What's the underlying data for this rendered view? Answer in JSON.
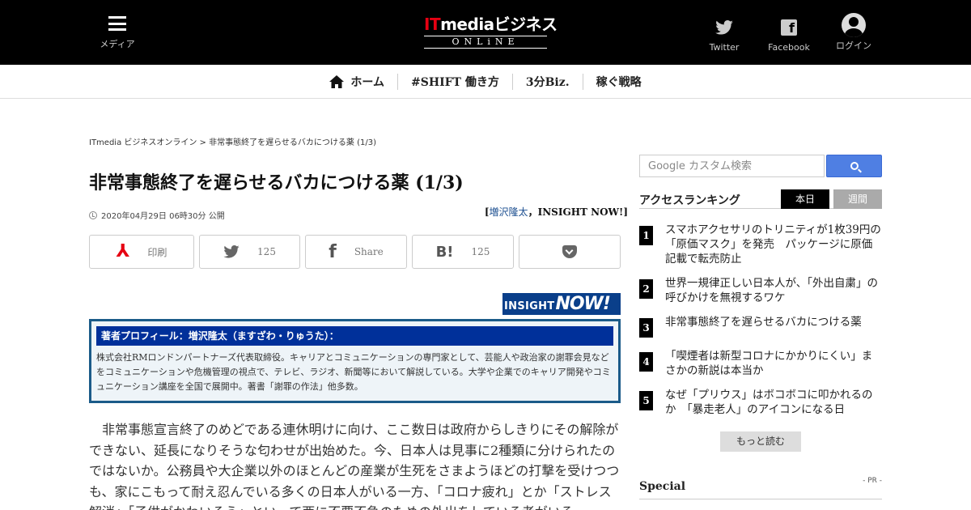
{
  "header": {
    "menu_label": "メディア",
    "logo_it": "IT",
    "logo_main": "mediaビジネス",
    "logo_sub": "ONLiNE",
    "twitter_label": "Twitter",
    "facebook_label": "Facebook",
    "login_label": "ログイン",
    "facebook_glyph": "f"
  },
  "nav": {
    "items": [
      {
        "label": "ホーム"
      },
      {
        "label": "#SHIFT 働き方"
      },
      {
        "label": "3分Biz."
      },
      {
        "label": "稼ぐ戦略"
      }
    ]
  },
  "article": {
    "breadcrumb": "ITmedia ビジネスオンライン > 非常事態終了を遅らせるバカにつける薬 (1/3)",
    "title": "非常事態終了を遅らせるバカにつける薬 (1/3)",
    "date": "2020年04月29日 06時30分 公開",
    "author_open": "[",
    "author_name": "増沢隆太",
    "author_sep": "，",
    "author_org": "INSIGHT NOW!",
    "author_close": "]",
    "share": {
      "print_label": "印刷",
      "twitter_count": "125",
      "facebook_label": "Share",
      "hatena_count": "125",
      "pdf_glyph": "⅄",
      "facebook_glyph": "f",
      "hatena_glyph": "B!"
    },
    "badge_a": "INSIGHT",
    "badge_b": "NOW!",
    "profile_head": "著者プロフィール：増沢隆太（ますざわ・りゅうた）：",
    "profile_body": "株式会社RMロンドンパートナーズ代表取締役。キャリアとコミュニケーションの専門家として、芸能人や政治家の謝罪会見などをコミュニケーションや危機管理の視点で、テレビ、ラジオ、新聞等において解説している。大学や企業でのキャリア開発やコミュニケーション講座を全国で展開中。著書「謝罪の作法」他多数。",
    "body": "非常事態宣言終了のめどである連休明けに向け、ここ数日は政府からしきりにその解除ができない、延長になりそうな匂わせが出始めた。今、日本人は見事に2種類に分けられたのではないか。公務員や大企業以外のほとんどの産業が生死をさまようほどの打撃を受けつつも、家にこもって耐え忍んでいる多くの日本人がいる一方、「コロナ疲れ」とか「ストレス解消」「子供がかわいそう」といって西に不要不急のための外出をしている者がいる。"
  },
  "sidebar": {
    "search_placeholder": "Google カスタム検索",
    "ranking_title": "アクセスランキング",
    "tab_today": "本日",
    "tab_week": "週間",
    "ranking": [
      {
        "num": "1",
        "text": "スマホアクセサリのトリニティが1枚39円の「原価マスク」を発売　パッケージに原価記載で転売防止"
      },
      {
        "num": "2",
        "text": "世界一規律正しい日本人が、「外出自粛」の呼びかけを無視するワケ"
      },
      {
        "num": "3",
        "text": "非常事態終了を遅らせるバカにつける薬"
      },
      {
        "num": "4",
        "text": "「喫煙者は新型コロナにかかりにくい」まさかの新説は本当か"
      },
      {
        "num": "5",
        "text": "なぜ「プリウス」はボコボコに叩かれるのか　「暴走老人」のアイコンになる日"
      }
    ],
    "more_label": "もっと読む",
    "special_title": "Special",
    "pr_label": "- PR -"
  },
  "colors": {
    "header_bg": "#000000",
    "logo_accent": "#e60012",
    "profile_header": "#00309a",
    "profile_border": "#1b5b89",
    "search_button": "#4f7fe3",
    "insight_badge": "#0a3f8a"
  }
}
